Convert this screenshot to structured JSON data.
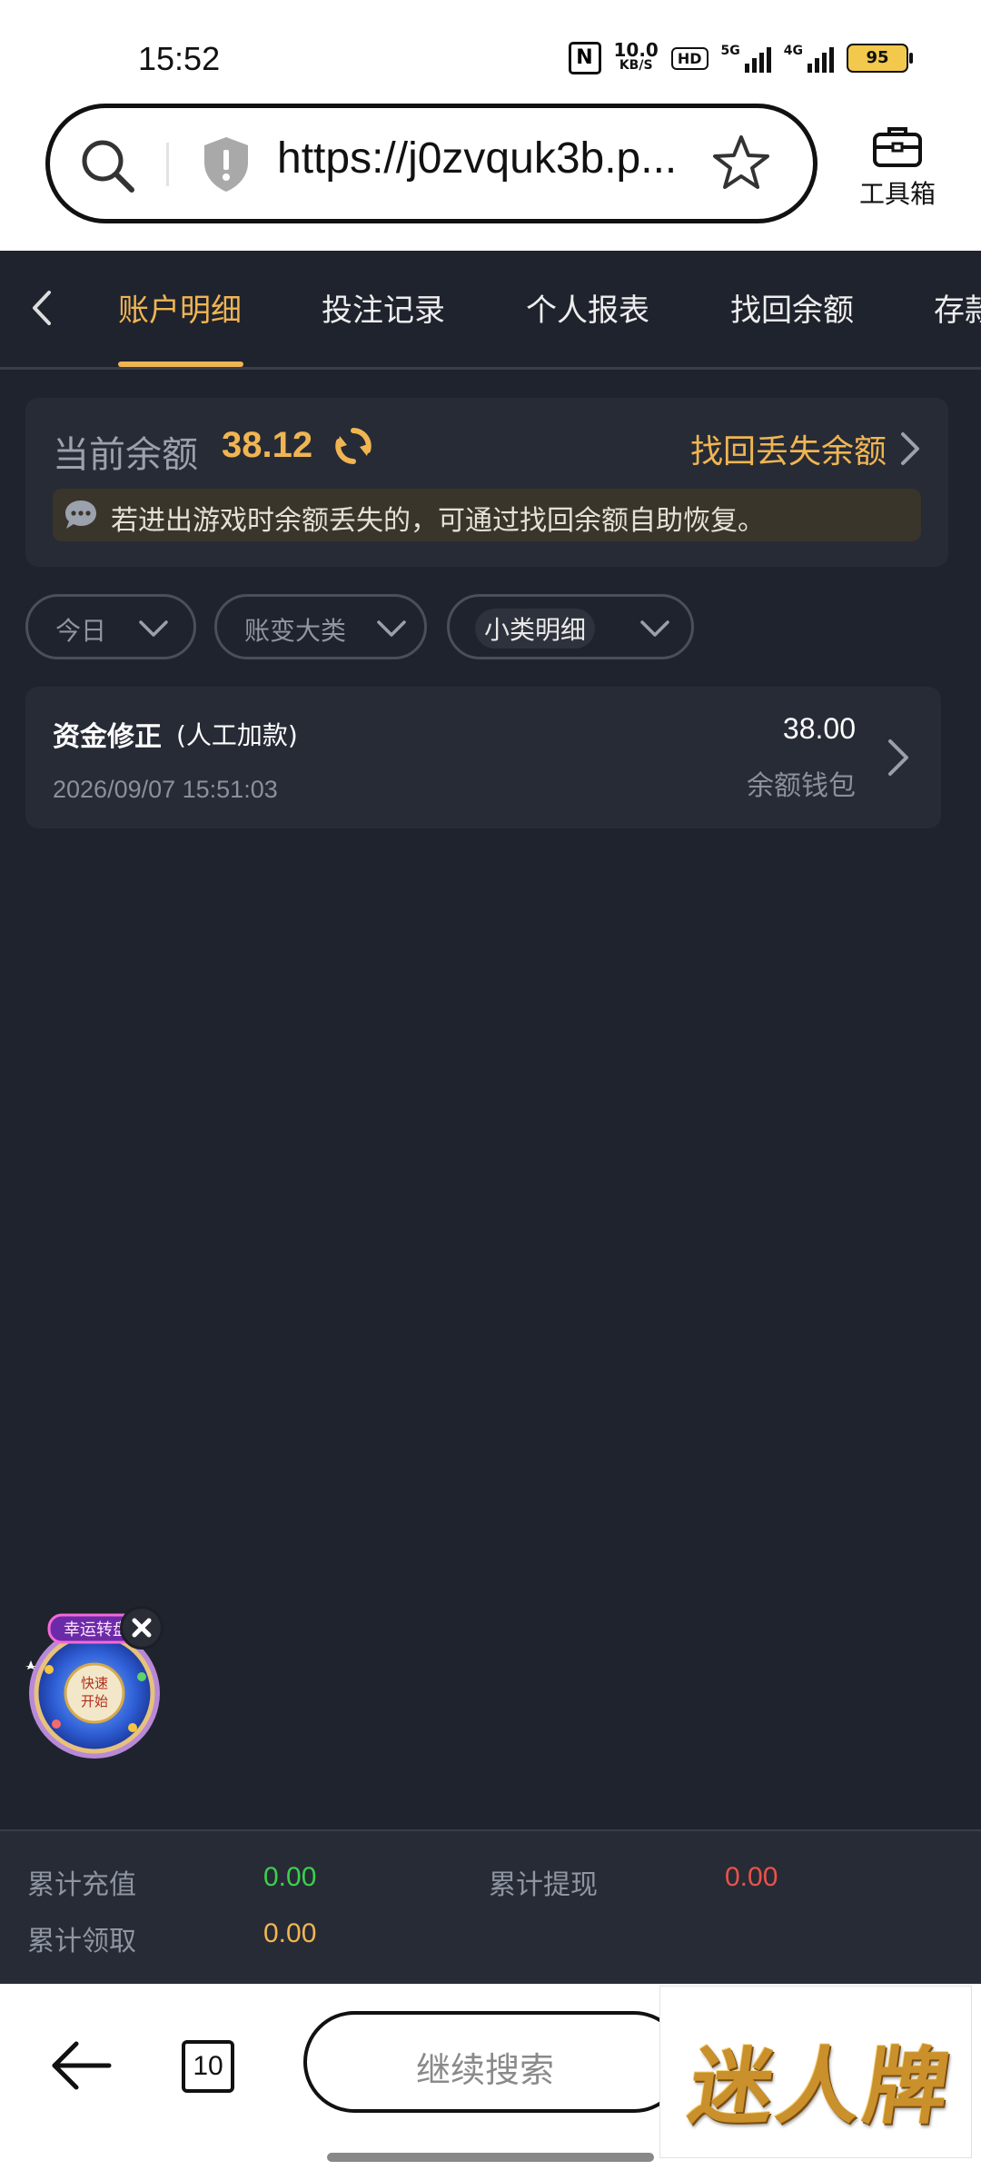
{
  "status_bar": {
    "time": "15:52",
    "net_speed_value": "10.0",
    "net_speed_unit": "KB/S",
    "hd_label": "HD",
    "signal1_label": "5G",
    "signal2_label": "4G",
    "battery": "95"
  },
  "browser": {
    "url": "https://j0zvquk3b.p...",
    "toolbox_label": "工具箱"
  },
  "tabs": [
    {
      "label": "账户明细",
      "active": true
    },
    {
      "label": "投注记录",
      "active": false
    },
    {
      "label": "个人报表",
      "active": false
    },
    {
      "label": "找回余额",
      "active": false
    },
    {
      "label": "存款",
      "active": false
    }
  ],
  "balance": {
    "label": "当前余额",
    "value": "38.12",
    "recover_link": "找回丢失余额",
    "notice": "若进出游戏时余额丢失的，可通过找回余额自助恢复。"
  },
  "filters": [
    {
      "label": "今日"
    },
    {
      "label": "账变大类"
    },
    {
      "label": "小类明细"
    }
  ],
  "transactions": [
    {
      "title": "资金修正",
      "subtitle": "(人工加款)",
      "date": "2026/09/07 15:51:03",
      "amount": "38.00",
      "wallet": "余额钱包"
    }
  ],
  "wheel": {
    "center_text": "快速开始",
    "banner_text": "幸运转盘"
  },
  "totals": {
    "recharge_label": "累计充值",
    "recharge_value": "0.00",
    "withdraw_label": "累计提现",
    "withdraw_value": "0.00",
    "claim_label": "累计领取",
    "claim_value": "0.00"
  },
  "bottom_bar": {
    "tab_count": "10",
    "search_label": "继续搜索",
    "ad_logo_text": "迷人牌"
  },
  "colors": {
    "accent": "#f0b552",
    "recharge": "#3ccf4e",
    "withdraw": "#e8534b",
    "claim": "#f0b552",
    "background": "#1f232d",
    "card": "#272b35"
  }
}
